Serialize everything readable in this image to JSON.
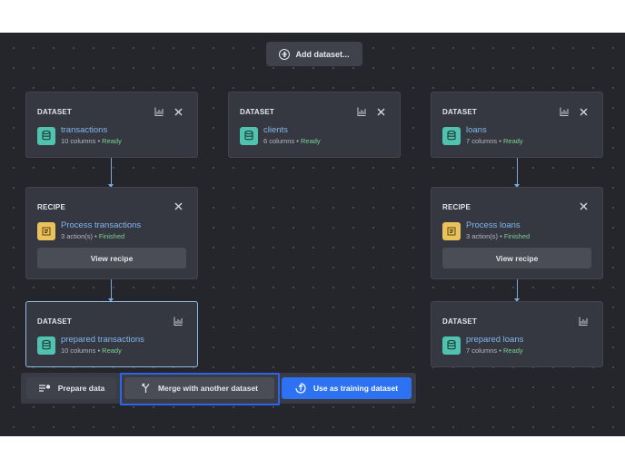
{
  "toolbar_top": {
    "add_dataset_label": "Add dataset..."
  },
  "cards": {
    "transactions": {
      "type": "DATASET",
      "name": "transactions",
      "meta": "10 columns",
      "status": "Ready"
    },
    "clients": {
      "type": "DATASET",
      "name": "clients",
      "meta": "6 columns",
      "status": "Ready"
    },
    "loans": {
      "type": "DATASET",
      "name": "loans",
      "meta": "7 columns",
      "status": "Ready"
    },
    "recipe_transactions": {
      "type": "RECIPE",
      "name": "Process transactions",
      "meta": "3 action(s)",
      "status": "Finished",
      "button": "View recipe"
    },
    "recipe_loans": {
      "type": "RECIPE",
      "name": "Process loans",
      "meta": "3 action(s)",
      "status": "Finished",
      "button": "View recipe"
    },
    "prepared_transactions": {
      "type": "DATASET",
      "name": "prepared transactions",
      "meta": "10 columns",
      "status": "Ready"
    },
    "prepared_loans": {
      "type": "DATASET",
      "name": "prepared loans",
      "meta": "7 columns",
      "status": "Ready"
    }
  },
  "separator": " • ",
  "action_bar": {
    "prepare_label": "Prepare data",
    "merge_label": "Merge with another dataset",
    "train_label": "Use as training dataset"
  },
  "colors": {
    "accent": "#2c72f2",
    "dataset_icon": "#4fc3b0",
    "recipe_icon": "#e9c25d",
    "link": "#7fb6ee",
    "status": "#7ccf95",
    "highlight": "#2f64e8"
  },
  "icons": [
    "plus-circle-icon",
    "chart-icon",
    "close-icon",
    "database-icon",
    "recipe-icon",
    "prepare-icon",
    "merge-icon",
    "train-icon"
  ]
}
